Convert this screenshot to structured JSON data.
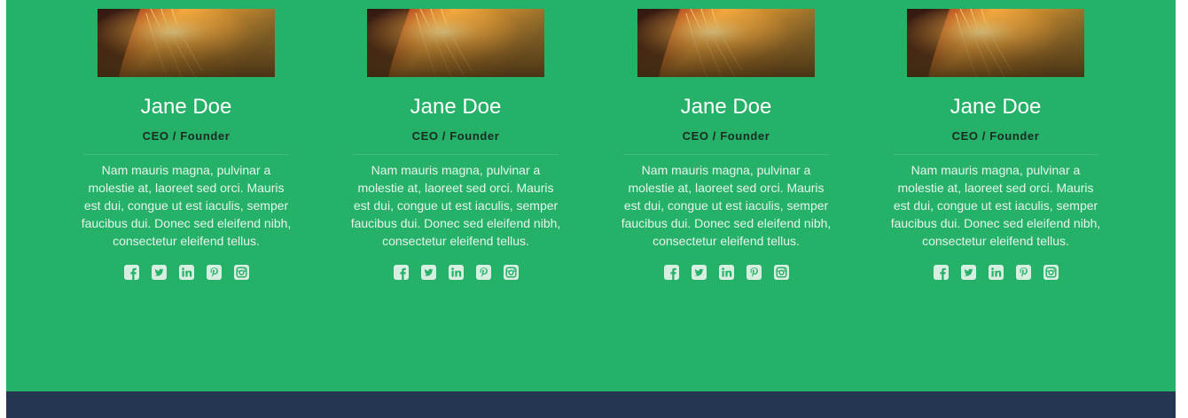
{
  "team": [
    {
      "name": "Jane Doe",
      "role": "CEO / Founder",
      "bio": "Nam mauris magna, pulvinar a molestie at, laoreet sed orci. Mauris est dui, congue ut est iaculis, semper faucibus dui. Donec sed eleifend nibh, consectetur eleifend tellus.",
      "socials": [
        "facebook-icon",
        "twitter-icon",
        "linkedin-icon",
        "pinterest-icon",
        "instagram-icon"
      ]
    },
    {
      "name": "Jane Doe",
      "role": "CEO / Founder",
      "bio": "Nam mauris magna, pulvinar a molestie at, laoreet sed orci. Mauris est dui, congue ut est iaculis, semper faucibus dui. Donec sed eleifend nibh, consectetur eleifend tellus.",
      "socials": [
        "facebook-icon",
        "twitter-icon",
        "linkedin-icon",
        "pinterest-icon",
        "instagram-icon"
      ]
    },
    {
      "name": "Jane Doe",
      "role": "CEO / Founder",
      "bio": "Nam mauris magna, pulvinar a molestie at, laoreet sed orci. Mauris est dui, congue ut est iaculis, semper faucibus dui. Donec sed eleifend nibh, consectetur eleifend tellus.",
      "socials": [
        "facebook-icon",
        "twitter-icon",
        "linkedin-icon",
        "pinterest-icon",
        "instagram-icon"
      ]
    },
    {
      "name": "Jane Doe",
      "role": "CEO / Founder",
      "bio": "Nam mauris magna, pulvinar a molestie at, laoreet sed orci. Mauris est dui, congue ut est iaculis, semper faucibus dui. Donec sed eleifend nibh, consectetur eleifend tellus.",
      "socials": [
        "facebook-icon",
        "twitter-icon",
        "linkedin-icon",
        "pinterest-icon",
        "instagram-icon"
      ]
    }
  ],
  "colors": {
    "section_bg": "#25b168",
    "footer_bg": "#243650",
    "icon": "#d6efe0"
  }
}
